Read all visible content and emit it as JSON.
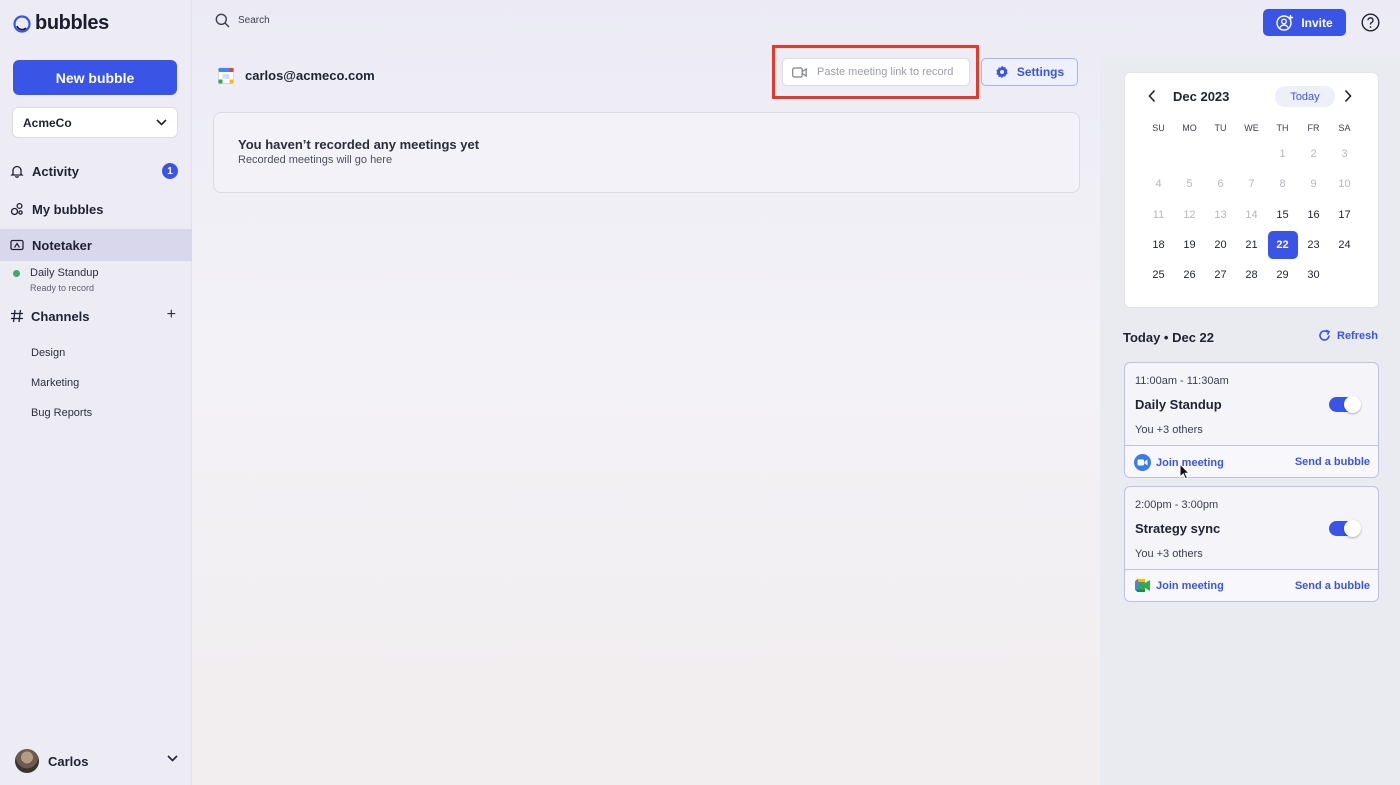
{
  "app": {
    "logo_text": "bubbles",
    "accent_color": "#3a55e6"
  },
  "sidebar": {
    "new_bubble_label": "New bubble",
    "workspace_selected": "AcmeCo",
    "nav": {
      "activity": {
        "label": "Activity",
        "badge": "1",
        "icon": "bell-icon"
      },
      "my_bubbles": {
        "label": "My bubbles",
        "icon": "bubbles-icon"
      },
      "notetaker": {
        "label": "Notetaker",
        "icon": "notetaker-icon",
        "active": true
      }
    },
    "notetaker_meeting": {
      "title": "Daily Standup",
      "status": "Ready to record",
      "status_color": "#3daa6a"
    },
    "channels": {
      "label": "Channels",
      "add_label": "+",
      "items": [
        "Design",
        "Marketing",
        "Bug Reports"
      ]
    },
    "user": {
      "name": "Carlos"
    }
  },
  "topbar": {
    "search_label": "Search",
    "invite_label": "Invite"
  },
  "main": {
    "account_email": "carlos@acmeco.com",
    "paste_placeholder": "Paste meeting link to record",
    "settings_label": "Settings",
    "highlight_color": "#e6392b",
    "empty_state": {
      "title": "You haven’t recorded any meetings yet",
      "subtitle": "Recorded meetings will go here"
    }
  },
  "calendar": {
    "month_label": "Dec 2023",
    "today_label": "Today",
    "weekdays": [
      "SU",
      "MO",
      "TU",
      "WE",
      "TH",
      "FR",
      "SA"
    ],
    "weeks": [
      [
        null,
        null,
        null,
        null,
        "1",
        "2",
        "3"
      ],
      [
        "4",
        "5",
        "6",
        "7",
        "8",
        "9",
        "10"
      ],
      [
        "11",
        "12",
        "13",
        "14",
        "15",
        "16",
        "17"
      ],
      [
        "18",
        "19",
        "20",
        "21",
        "22",
        "23",
        "24"
      ],
      [
        "25",
        "26",
        "27",
        "28",
        "29",
        "30",
        null
      ]
    ],
    "muted_through": "14",
    "selected_day": "22"
  },
  "schedule": {
    "day_label": "Today • Dec 22",
    "refresh_label": "Refresh",
    "meetings": [
      {
        "time": "11:00am - 11:30am",
        "title": "Daily Standup",
        "attendees": "You +3 others",
        "recording_enabled": true,
        "provider_icon": "zoom-icon",
        "join_label": "Join meeting",
        "send_label": "Send a bubble"
      },
      {
        "time": "2:00pm - 3:00pm",
        "title": "Strategy sync",
        "attendees": "You +3 others",
        "recording_enabled": true,
        "provider_icon": "google-meet-icon",
        "join_label": "Join meeting",
        "send_label": "Send a bubble"
      }
    ]
  }
}
